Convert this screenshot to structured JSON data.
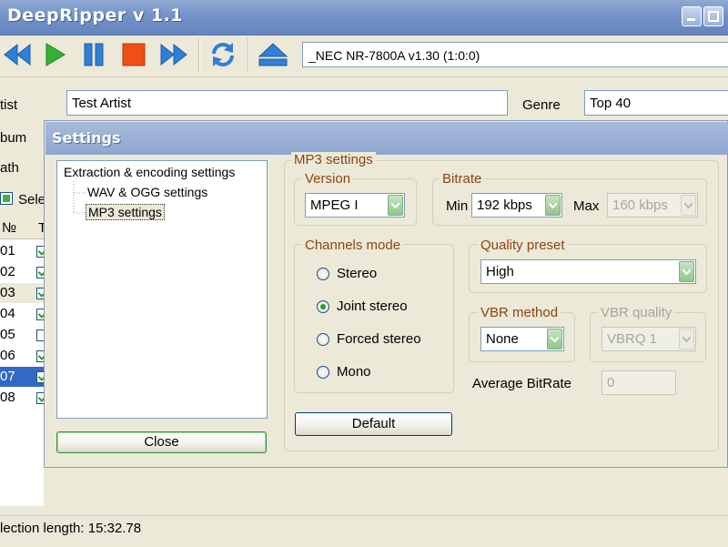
{
  "app": {
    "title": "DeepRipper v 1.1"
  },
  "toolbar": {
    "drive": "_NEC NR-7800A v1.30 (1:0:0)"
  },
  "info": {
    "artist_label": "tist",
    "artist_value": "Test Artist",
    "album_label": "bum",
    "path_label": "ath",
    "genre_label": "Genre",
    "genre_value": "Top 40",
    "select_label": "Sele"
  },
  "tracks": {
    "header_num": "№",
    "header_t": "T",
    "rows": [
      {
        "num": "01",
        "checked": true
      },
      {
        "num": "02",
        "checked": true
      },
      {
        "num": "03",
        "checked": true
      },
      {
        "num": "04",
        "checked": true
      },
      {
        "num": "05",
        "checked": false
      },
      {
        "num": "06",
        "checked": true
      },
      {
        "num": "07",
        "checked": true
      },
      {
        "num": "08",
        "checked": true
      }
    ]
  },
  "status": {
    "text": "lection length:  15:32.78"
  },
  "settings": {
    "title": "Settings",
    "tree": {
      "root": "Extraction & encoding settings",
      "child1": "WAV & OGG settings",
      "child2": "MP3 settings"
    },
    "close_label": "Close",
    "mp3_group": "MP3 settings",
    "version_group": "Version",
    "version_value": "MPEG I",
    "bitrate_group": "Bitrate",
    "min_label": "Min",
    "min_value": "192 kbps",
    "max_label": "Max",
    "max_value": "160 kbps",
    "channels_group": "Channels mode",
    "channels": [
      {
        "label": "Stereo",
        "selected": false
      },
      {
        "label": "Joint stereo",
        "selected": true
      },
      {
        "label": "Forced stereo",
        "selected": false
      },
      {
        "label": "Mono",
        "selected": false
      }
    ],
    "quality_group": "Quality preset",
    "quality_value": "High",
    "vbr_method_group": "VBR method",
    "vbr_method_value": "None",
    "vbr_quality_group": "VBR quality",
    "vbr_quality_value": "VBRQ 1",
    "avg_label": "Average BitRate",
    "avg_value": "0",
    "default_label": "Default"
  },
  "colors": {
    "accent_green": "#21A121",
    "title_blue": "#7090C6",
    "group_title": "#8B4513",
    "selection": "#316AC5"
  }
}
